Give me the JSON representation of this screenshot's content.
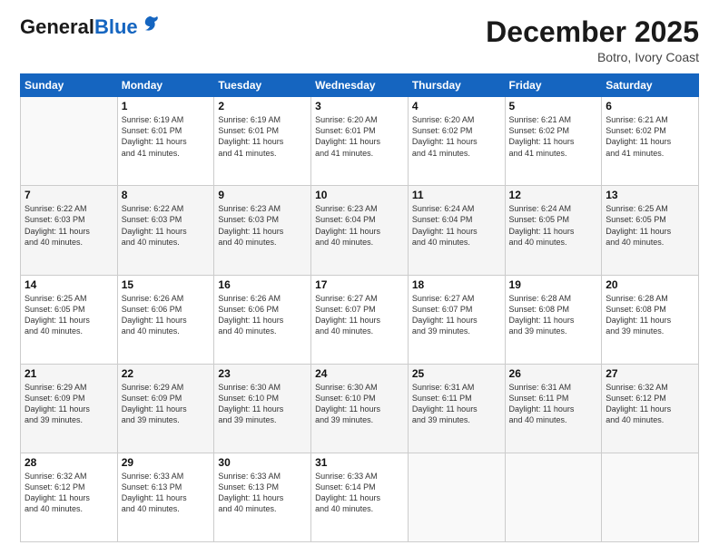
{
  "header": {
    "logo_general": "General",
    "logo_blue": "Blue",
    "month_title": "December 2025",
    "subtitle": "Botro, Ivory Coast"
  },
  "days_of_week": [
    "Sunday",
    "Monday",
    "Tuesday",
    "Wednesday",
    "Thursday",
    "Friday",
    "Saturday"
  ],
  "weeks": [
    [
      {
        "num": "",
        "info": ""
      },
      {
        "num": "1",
        "info": "Sunrise: 6:19 AM\nSunset: 6:01 PM\nDaylight: 11 hours\nand 41 minutes."
      },
      {
        "num": "2",
        "info": "Sunrise: 6:19 AM\nSunset: 6:01 PM\nDaylight: 11 hours\nand 41 minutes."
      },
      {
        "num": "3",
        "info": "Sunrise: 6:20 AM\nSunset: 6:01 PM\nDaylight: 11 hours\nand 41 minutes."
      },
      {
        "num": "4",
        "info": "Sunrise: 6:20 AM\nSunset: 6:02 PM\nDaylight: 11 hours\nand 41 minutes."
      },
      {
        "num": "5",
        "info": "Sunrise: 6:21 AM\nSunset: 6:02 PM\nDaylight: 11 hours\nand 41 minutes."
      },
      {
        "num": "6",
        "info": "Sunrise: 6:21 AM\nSunset: 6:02 PM\nDaylight: 11 hours\nand 41 minutes."
      }
    ],
    [
      {
        "num": "7",
        "info": "Sunrise: 6:22 AM\nSunset: 6:03 PM\nDaylight: 11 hours\nand 40 minutes."
      },
      {
        "num": "8",
        "info": "Sunrise: 6:22 AM\nSunset: 6:03 PM\nDaylight: 11 hours\nand 40 minutes."
      },
      {
        "num": "9",
        "info": "Sunrise: 6:23 AM\nSunset: 6:03 PM\nDaylight: 11 hours\nand 40 minutes."
      },
      {
        "num": "10",
        "info": "Sunrise: 6:23 AM\nSunset: 6:04 PM\nDaylight: 11 hours\nand 40 minutes."
      },
      {
        "num": "11",
        "info": "Sunrise: 6:24 AM\nSunset: 6:04 PM\nDaylight: 11 hours\nand 40 minutes."
      },
      {
        "num": "12",
        "info": "Sunrise: 6:24 AM\nSunset: 6:05 PM\nDaylight: 11 hours\nand 40 minutes."
      },
      {
        "num": "13",
        "info": "Sunrise: 6:25 AM\nSunset: 6:05 PM\nDaylight: 11 hours\nand 40 minutes."
      }
    ],
    [
      {
        "num": "14",
        "info": "Sunrise: 6:25 AM\nSunset: 6:05 PM\nDaylight: 11 hours\nand 40 minutes."
      },
      {
        "num": "15",
        "info": "Sunrise: 6:26 AM\nSunset: 6:06 PM\nDaylight: 11 hours\nand 40 minutes."
      },
      {
        "num": "16",
        "info": "Sunrise: 6:26 AM\nSunset: 6:06 PM\nDaylight: 11 hours\nand 40 minutes."
      },
      {
        "num": "17",
        "info": "Sunrise: 6:27 AM\nSunset: 6:07 PM\nDaylight: 11 hours\nand 40 minutes."
      },
      {
        "num": "18",
        "info": "Sunrise: 6:27 AM\nSunset: 6:07 PM\nDaylight: 11 hours\nand 39 minutes."
      },
      {
        "num": "19",
        "info": "Sunrise: 6:28 AM\nSunset: 6:08 PM\nDaylight: 11 hours\nand 39 minutes."
      },
      {
        "num": "20",
        "info": "Sunrise: 6:28 AM\nSunset: 6:08 PM\nDaylight: 11 hours\nand 39 minutes."
      }
    ],
    [
      {
        "num": "21",
        "info": "Sunrise: 6:29 AM\nSunset: 6:09 PM\nDaylight: 11 hours\nand 39 minutes."
      },
      {
        "num": "22",
        "info": "Sunrise: 6:29 AM\nSunset: 6:09 PM\nDaylight: 11 hours\nand 39 minutes."
      },
      {
        "num": "23",
        "info": "Sunrise: 6:30 AM\nSunset: 6:10 PM\nDaylight: 11 hours\nand 39 minutes."
      },
      {
        "num": "24",
        "info": "Sunrise: 6:30 AM\nSunset: 6:10 PM\nDaylight: 11 hours\nand 39 minutes."
      },
      {
        "num": "25",
        "info": "Sunrise: 6:31 AM\nSunset: 6:11 PM\nDaylight: 11 hours\nand 39 minutes."
      },
      {
        "num": "26",
        "info": "Sunrise: 6:31 AM\nSunset: 6:11 PM\nDaylight: 11 hours\nand 40 minutes."
      },
      {
        "num": "27",
        "info": "Sunrise: 6:32 AM\nSunset: 6:12 PM\nDaylight: 11 hours\nand 40 minutes."
      }
    ],
    [
      {
        "num": "28",
        "info": "Sunrise: 6:32 AM\nSunset: 6:12 PM\nDaylight: 11 hours\nand 40 minutes."
      },
      {
        "num": "29",
        "info": "Sunrise: 6:33 AM\nSunset: 6:13 PM\nDaylight: 11 hours\nand 40 minutes."
      },
      {
        "num": "30",
        "info": "Sunrise: 6:33 AM\nSunset: 6:13 PM\nDaylight: 11 hours\nand 40 minutes."
      },
      {
        "num": "31",
        "info": "Sunrise: 6:33 AM\nSunset: 6:14 PM\nDaylight: 11 hours\nand 40 minutes."
      },
      {
        "num": "",
        "info": ""
      },
      {
        "num": "",
        "info": ""
      },
      {
        "num": "",
        "info": ""
      }
    ]
  ]
}
